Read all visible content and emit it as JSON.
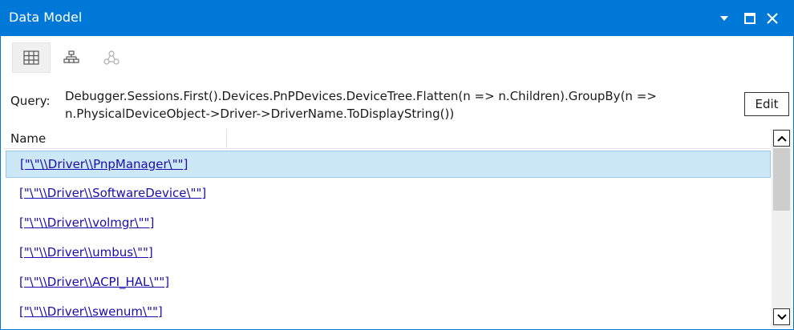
{
  "window": {
    "title": "Data Model"
  },
  "icons": {
    "menu": "dropdown-arrow-icon",
    "maximize": "maximize-icon",
    "close": "close-icon",
    "grid": "grid-view-icon",
    "tree": "hierarchy-view-icon",
    "graph": "graph-view-icon",
    "scroll_up": "chevron-up-icon",
    "scroll_down": "chevron-down-icon"
  },
  "query": {
    "label": "Query:",
    "line1": "Debugger.Sessions.First().Devices.PnPDevices.DeviceTree.Flatten(n => n.Children).GroupBy(n =>",
    "line2": "n.PhysicalDeviceObject->Driver->DriverName.ToDisplayString())",
    "edit_label": "Edit"
  },
  "table": {
    "columns": [
      "Name"
    ],
    "rows": [
      {
        "label": "[\"\\\"\\\\Driver\\\\PnpManager\\\"\"]",
        "selected": true
      },
      {
        "label": "[\"\\\"\\\\Driver\\\\SoftwareDevice\\\"\"]",
        "selected": false
      },
      {
        "label": "[\"\\\"\\\\Driver\\\\volmgr\\\"\"]",
        "selected": false
      },
      {
        "label": "[\"\\\"\\\\Driver\\\\umbus\\\"\"]",
        "selected": false
      },
      {
        "label": "[\"\\\"\\\\Driver\\\\ACPI_HAL\\\"\"]",
        "selected": false
      },
      {
        "label": "[\"\\\"\\\\Driver\\\\swenum\\\"\"]",
        "selected": false
      }
    ]
  },
  "colors": {
    "accent": "#0078d7",
    "selection": "#cce8f7",
    "link": "#1a0dab"
  }
}
